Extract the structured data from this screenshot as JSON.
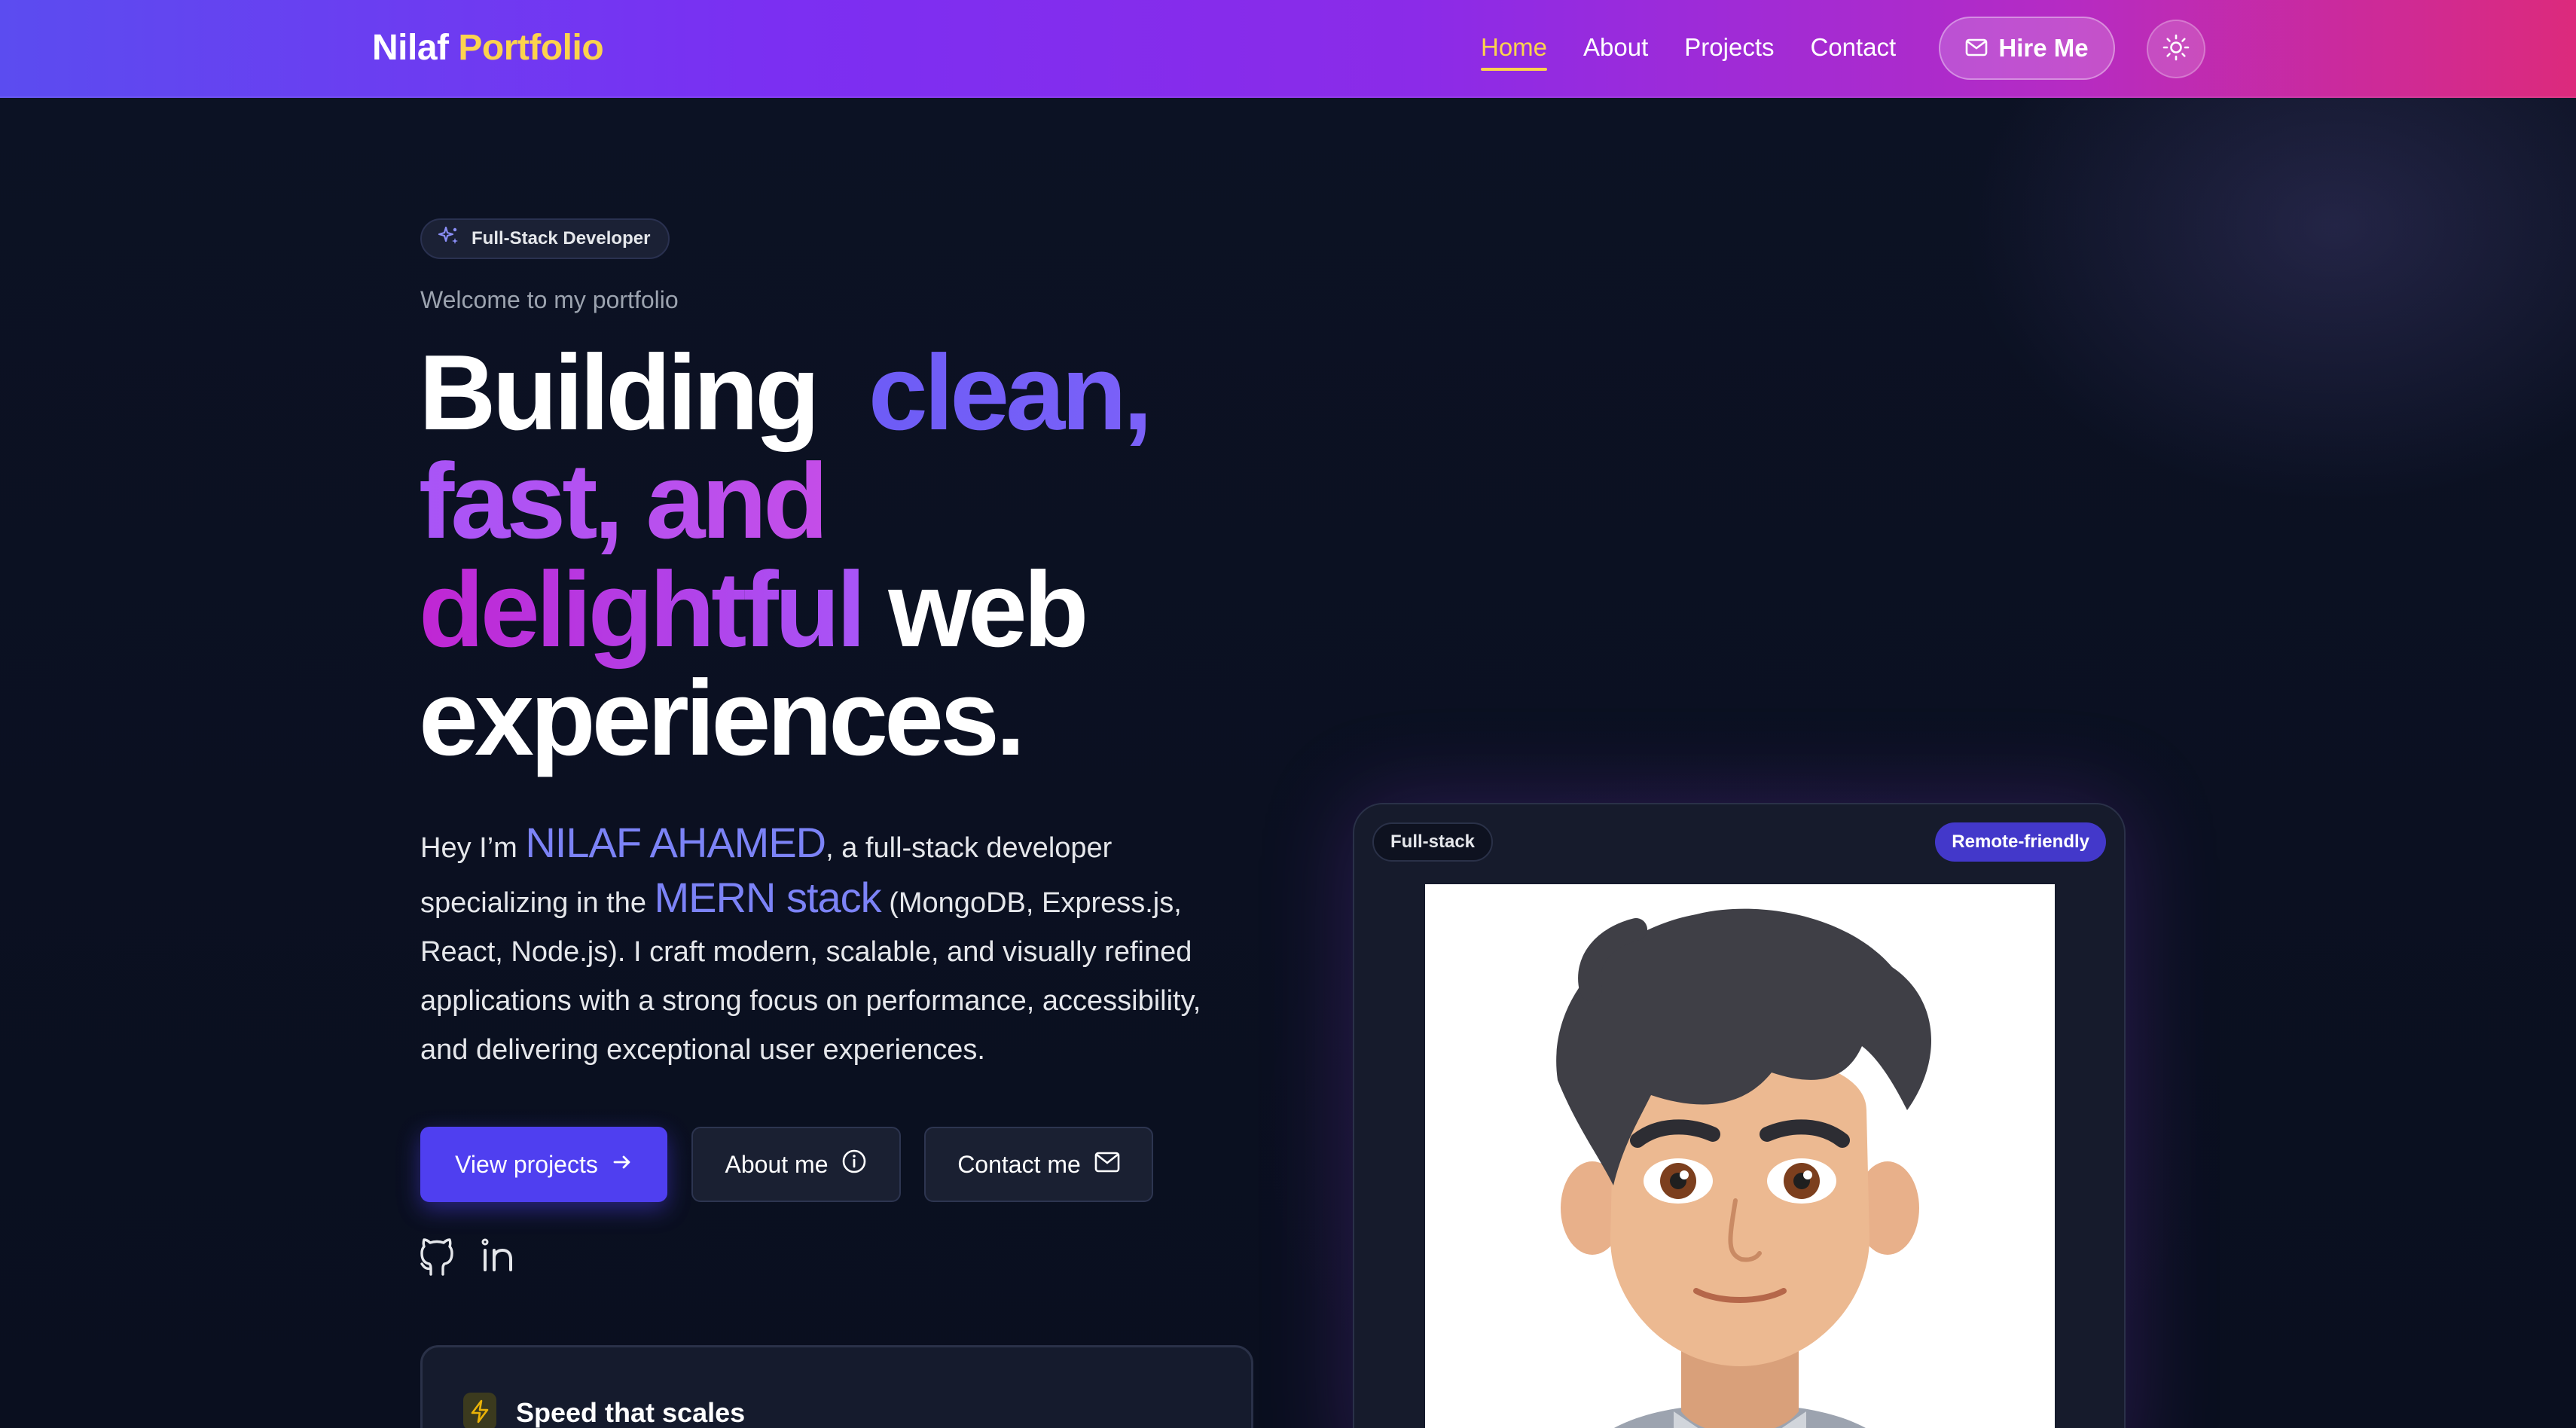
{
  "nav": {
    "brand_first": "Nilaf",
    "brand_second": "Portfolio",
    "links": [
      "Home",
      "About",
      "Projects",
      "Contact"
    ],
    "active": "Home",
    "hire_label": "Hire Me",
    "hire_icon": "mail-icon",
    "theme_icon": "sun-icon"
  },
  "hero": {
    "badge": "Full-Stack Developer",
    "badge_icon": "sparkles-icon",
    "welcome": "Welcome to my portfolio",
    "headline": {
      "w1": "Building",
      "w2": "clean,",
      "w3": "fast, and",
      "w4": "delightful",
      "w5": "web",
      "w6": "experiences."
    },
    "intro": {
      "p1": "Hey I’m ",
      "name": "NILAF AHAMED",
      "p2": ", a full-stack developer specializing in the ",
      "stack": "MERN stack",
      "p3": " (MongoDB, Express.js, React, Node.js). I craft modern, scalable, and visually refined applications with a strong focus on performance, accessibility, and delivering exceptional user experiences."
    },
    "buttons": {
      "view_projects": "View projects",
      "about_me": "About me",
      "contact_me": "Contact me"
    },
    "social": [
      "github-icon",
      "linkedin-icon"
    ]
  },
  "feature": {
    "title": "Speed that scales",
    "icon": "bolt-icon"
  },
  "profile": {
    "tag_left": "Full-stack",
    "tag_right": "Remote-friendly"
  },
  "colors": {
    "accent": "#4f3ff0",
    "highlight": "#fcd34d",
    "name_color": "#7c83f7"
  }
}
